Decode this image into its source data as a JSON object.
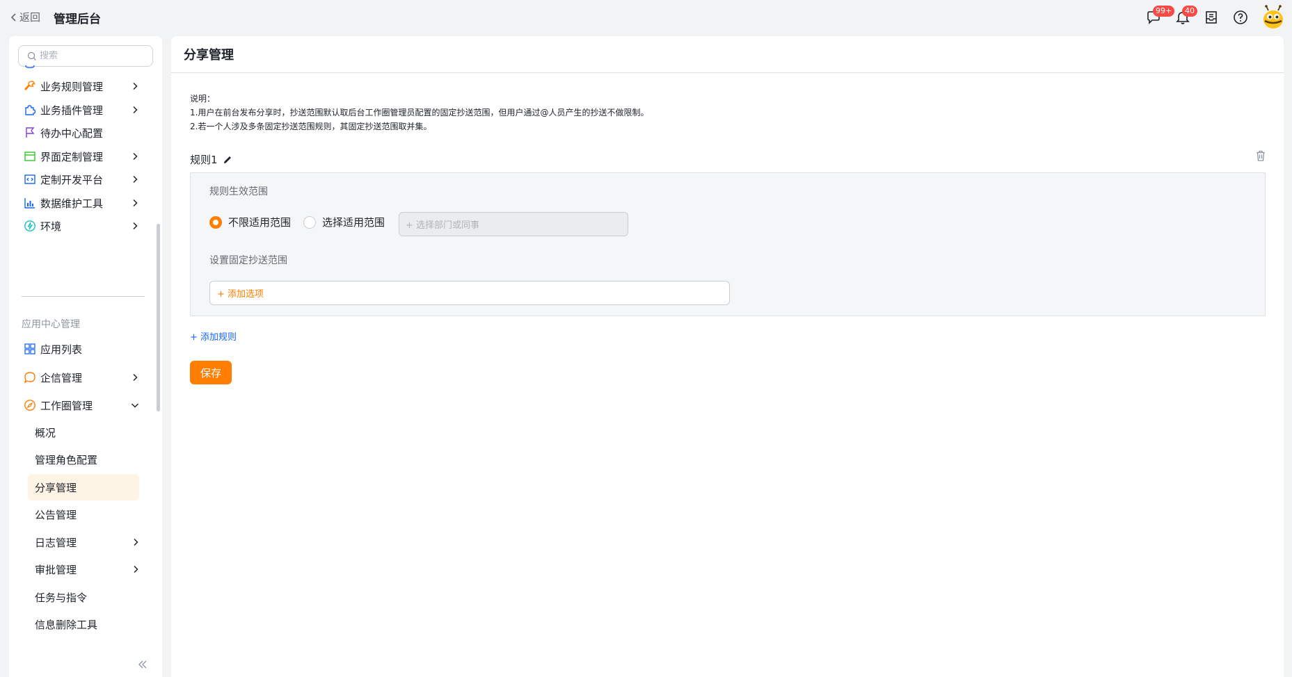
{
  "topbar": {
    "back_label": "返回",
    "app_title": "管理后台",
    "message_badge": "99+",
    "notification_badge": "40"
  },
  "sidebar": {
    "search_placeholder": "搜索",
    "items": [
      {
        "label": "业务规则管理",
        "icon": "wrench-icon",
        "expandable": true
      },
      {
        "label": "业务插件管理",
        "icon": "puzzle-icon",
        "expandable": true
      },
      {
        "label": "待办中心配置",
        "icon": "flag-icon",
        "expandable": false
      },
      {
        "label": "界面定制管理",
        "icon": "window-icon",
        "expandable": true
      },
      {
        "label": "定制开发平台",
        "icon": "code-icon",
        "expandable": true
      },
      {
        "label": "数据维护工具",
        "icon": "bar-chart-icon",
        "expandable": true
      },
      {
        "label": "环境",
        "icon": "lightning-icon",
        "expandable": true
      }
    ],
    "group_title": "应用中心管理",
    "app_items": [
      {
        "label": "应用列表",
        "icon": "grid-icon",
        "expandable": false
      },
      {
        "label": "企信管理",
        "icon": "chat-bubble-icon",
        "expandable": true
      },
      {
        "label": "工作圈管理",
        "icon": "compass-icon",
        "expandable": true,
        "expanded": true
      }
    ],
    "sub_items": [
      {
        "label": "概况",
        "expandable": false
      },
      {
        "label": "管理角色配置",
        "expandable": false
      },
      {
        "label": "分享管理",
        "expandable": false,
        "active": true
      },
      {
        "label": "公告管理",
        "expandable": false
      },
      {
        "label": "日志管理",
        "expandable": true
      },
      {
        "label": "审批管理",
        "expandable": true
      },
      {
        "label": "任务与指令",
        "expandable": false
      },
      {
        "label": "信息删除工具",
        "expandable": false
      }
    ]
  },
  "main": {
    "page_title": "分享管理",
    "description": [
      "说明：",
      "1.用户在前台发布分享时，抄送范围默认取后台工作圈管理员配置的固定抄送范围，但用户通过@人员产生的抄送不做限制。",
      "2.若一个人涉及多条固定抄送范围规则，其固定抄送范围取并集。"
    ],
    "rule": {
      "title": "规则1",
      "scope_label": "规则生效范围",
      "option_unlimited": "不限适用范围",
      "option_select": "选择适用范围",
      "selected_option": "不限适用范围",
      "dept_placeholder": "+ 选择部门或同事",
      "fixed_cc_label": "设置固定抄送范围",
      "add_option": "+ 添加选项"
    },
    "add_rule": "+ 添加规则",
    "save": "保存"
  },
  "colors": {
    "accent": "#ff7d00",
    "link": "#1664ff",
    "active_bg": "#fef4e6",
    "badge": "#f54a45"
  }
}
